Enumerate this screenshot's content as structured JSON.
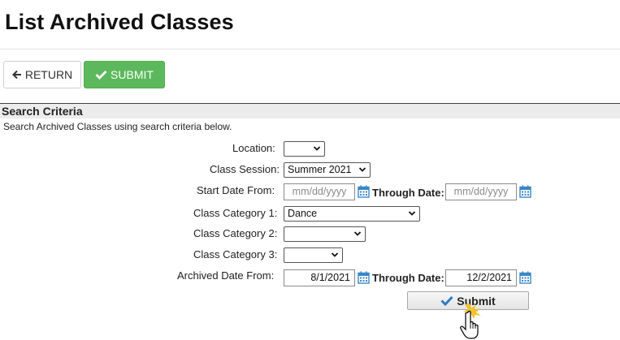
{
  "page": {
    "title": "List Archived Classes"
  },
  "toolbar": {
    "return_label": "RETURN",
    "submit_label": "SUBMIT"
  },
  "section": {
    "header": "Search Criteria",
    "description": "Search Archived Classes using search criteria below."
  },
  "form": {
    "location": {
      "label": "Location:",
      "value": ""
    },
    "class_session": {
      "label": "Class Session:",
      "value": "Summer 2021"
    },
    "start_date": {
      "label": "Start Date From:",
      "from_placeholder": "mm/dd/yyyy",
      "through_label": "Through Date:",
      "through_placeholder": "mm/dd/yyyy"
    },
    "category1": {
      "label": "Class Category 1:",
      "value": "Dance"
    },
    "category2": {
      "label": "Class Category 2:",
      "value": ""
    },
    "category3": {
      "label": "Class Category 3:",
      "value": ""
    },
    "archived_date": {
      "label": "Archived Date From:",
      "from_value": "8/1/2021",
      "through_label": "Through Date:",
      "through_value": "12/2/2021"
    },
    "submit_label": "Submit"
  },
  "colors": {
    "primary_green": "#5cb85c",
    "calendar_blue": "#3a87c8",
    "checkmark_blue": "#2e7bc4"
  }
}
